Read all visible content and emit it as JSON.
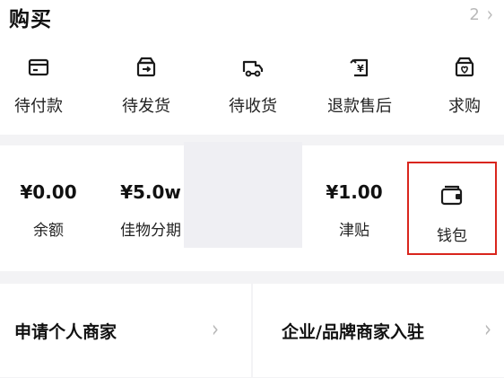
{
  "purchase": {
    "title": "购买",
    "more_count": "2",
    "orders": [
      {
        "label": "待付款",
        "icon": "card-icon"
      },
      {
        "label": "待发货",
        "icon": "package-icon"
      },
      {
        "label": "待收货",
        "icon": "truck-icon"
      },
      {
        "label": "退款售后",
        "icon": "refund-icon"
      },
      {
        "label": "求购",
        "icon": "heart-box-icon"
      }
    ]
  },
  "assets": {
    "items": [
      {
        "value": "¥0.00",
        "label": "余额"
      },
      {
        "value": "¥5.0w",
        "label": "佳物分期"
      },
      {
        "value": "¥1.00",
        "label": "津贴"
      }
    ],
    "wallet": {
      "label": "钱包",
      "icon": "wallet-icon"
    }
  },
  "merchant": {
    "personal": "申请个人商家",
    "enterprise": "企业/品牌商家入驻"
  },
  "colors": {
    "highlight": "#d9251d",
    "background": "#f3f3f5",
    "card": "#ffffff",
    "muted": "#b9b9b9"
  }
}
